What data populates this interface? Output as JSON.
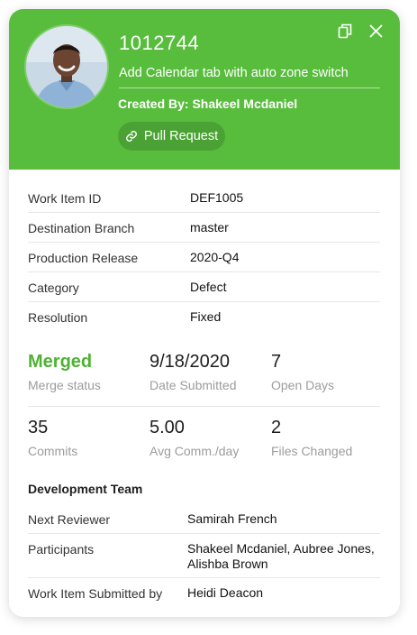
{
  "header": {
    "id": "1012744",
    "summary": "Add Calendar tab with auto zone switch",
    "created_by": "Created By: Shakeel Mcdaniel",
    "pull_request_label": "Pull Request",
    "background_color": "#58bd3d",
    "icons": [
      "copy-icon",
      "close-icon",
      "link-icon"
    ]
  },
  "details": [
    {
      "label": "Work Item ID",
      "value": "DEF1005"
    },
    {
      "label": "Destination Branch",
      "value": "master"
    },
    {
      "label": "Production Release",
      "value": "2020-Q4"
    },
    {
      "label": "Category",
      "value": "Defect"
    },
    {
      "label": "Resolution",
      "value": "Fixed"
    }
  ],
  "stats": [
    {
      "value": "Merged",
      "caption": "Merge status"
    },
    {
      "value": "9/18/2020",
      "caption": "Date Submitted"
    },
    {
      "value": "7",
      "caption": "Open Days"
    },
    {
      "value": "35",
      "caption": "Commits"
    },
    {
      "value": "5.00",
      "caption": "Avg Comm./day"
    },
    {
      "value": "2",
      "caption": "Files Changed"
    }
  ],
  "team": {
    "title": "Development Team",
    "rows": [
      {
        "label": "Next Reviewer",
        "value": "Samirah French"
      },
      {
        "label": "Participants",
        "value": "Shakeel Mcdaniel, Aubree Jones, Alishba Brown"
      },
      {
        "label": "Work Item Submitted by",
        "value": "Heidi Deacon"
      }
    ]
  },
  "colors": {
    "merged": "#4fb233",
    "caption": "#9c9c9c"
  }
}
